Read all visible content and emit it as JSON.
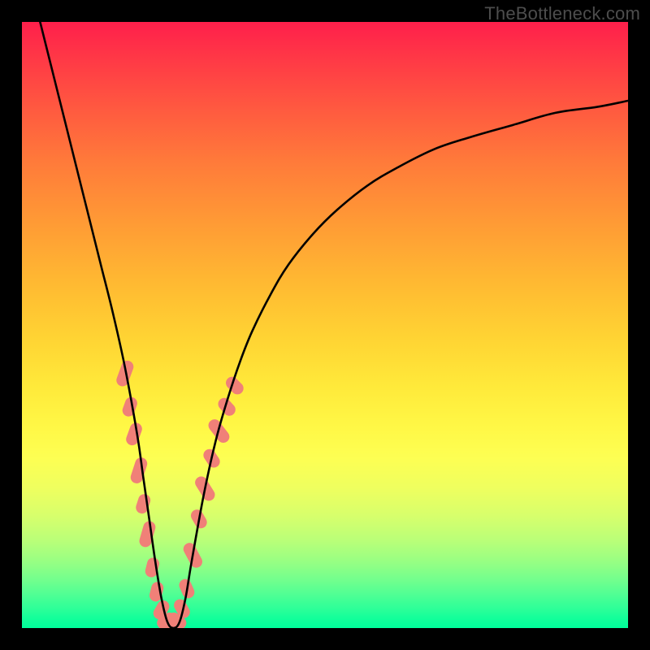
{
  "watermark": "TheBottleneck.com",
  "chart_data": {
    "type": "line",
    "title": "",
    "xlabel": "",
    "ylabel": "",
    "xlim": [
      0,
      100
    ],
    "ylim": [
      0,
      100
    ],
    "grid": false,
    "annotations": [
      "TheBottleneck.com"
    ],
    "series": [
      {
        "name": "bottleneck-curve",
        "color": "#000000",
        "x": [
          3,
          5,
          7,
          9,
          11,
          13,
          15,
          17,
          19,
          20,
          21,
          22,
          23,
          24,
          25,
          26,
          27,
          28,
          30,
          32,
          34,
          36,
          38,
          41,
          44,
          48,
          52,
          57,
          62,
          68,
          74,
          81,
          88,
          95,
          100
        ],
        "y": [
          100,
          92,
          84,
          76,
          68,
          60,
          52,
          43,
          32,
          25,
          18,
          11,
          5,
          1,
          0,
          1,
          5,
          11,
          22,
          31,
          38,
          44,
          49,
          55,
          60,
          65,
          69,
          73,
          76,
          79,
          81,
          83,
          85,
          86,
          87
        ]
      }
    ],
    "markers": [
      {
        "name": "left-cluster",
        "shape": "rounded-bar",
        "color": "#f08078",
        "points": [
          {
            "x": 17.0,
            "y": 42.0,
            "len": 6,
            "angle": -70
          },
          {
            "x": 17.8,
            "y": 36.5,
            "len": 4,
            "angle": -70
          },
          {
            "x": 18.5,
            "y": 32.0,
            "len": 5,
            "angle": -70
          },
          {
            "x": 19.3,
            "y": 26.0,
            "len": 6,
            "angle": -72
          },
          {
            "x": 20.0,
            "y": 20.5,
            "len": 4,
            "angle": -72
          },
          {
            "x": 20.7,
            "y": 15.5,
            "len": 6,
            "angle": -74
          },
          {
            "x": 21.5,
            "y": 10.0,
            "len": 4,
            "angle": -76
          },
          {
            "x": 22.2,
            "y": 6.0,
            "len": 4,
            "angle": -76
          },
          {
            "x": 23.0,
            "y": 3.0,
            "len": 4,
            "angle": -60
          },
          {
            "x": 23.8,
            "y": 1.2,
            "len": 4,
            "angle": -35
          },
          {
            "x": 24.7,
            "y": 0.5,
            "len": 4,
            "angle": 0
          },
          {
            "x": 25.6,
            "y": 1.2,
            "len": 4,
            "angle": 35
          },
          {
            "x": 26.4,
            "y": 3.2,
            "len": 4,
            "angle": 60
          },
          {
            "x": 27.2,
            "y": 6.5,
            "len": 4,
            "angle": 66
          }
        ]
      },
      {
        "name": "right-cluster",
        "shape": "rounded-bar",
        "color": "#f08078",
        "points": [
          {
            "x": 28.2,
            "y": 12.0,
            "len": 6,
            "angle": 62
          },
          {
            "x": 29.2,
            "y": 18.0,
            "len": 4,
            "angle": 60
          },
          {
            "x": 30.2,
            "y": 23.0,
            "len": 6,
            "angle": 58
          },
          {
            "x": 31.3,
            "y": 28.0,
            "len": 4,
            "angle": 56
          },
          {
            "x": 32.5,
            "y": 32.5,
            "len": 6,
            "angle": 52
          },
          {
            "x": 33.8,
            "y": 36.5,
            "len": 4,
            "angle": 48
          },
          {
            "x": 35.1,
            "y": 40.0,
            "len": 4,
            "angle": 45
          }
        ]
      }
    ]
  }
}
